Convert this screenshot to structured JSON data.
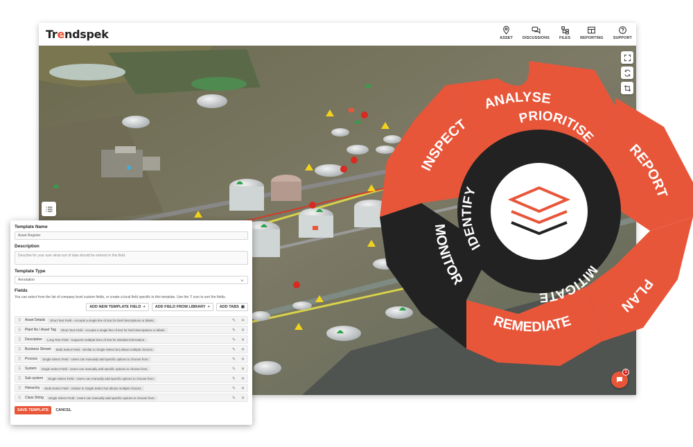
{
  "app": {
    "logo_prefix": "Tr",
    "logo_accent": "e",
    "logo_suffix": "ndspek",
    "accent_color": "#e8563a"
  },
  "nav": {
    "asset": "ASSET",
    "discussions": "DISCUSSIONS",
    "files": "FILES",
    "reporting": "REPORTING",
    "support": "SUPPORT"
  },
  "cycle": {
    "outer": [
      "ANALYSE",
      "REPORT",
      "PLAN",
      "REMEDIATE",
      "MONITOR",
      "INSPECT"
    ],
    "inner": [
      "PRIORITISE",
      "MITIGATE",
      "IDENTIFY"
    ],
    "colors": {
      "outer": "#e8563a",
      "dark": "#222222",
      "center": "#ffffff"
    }
  },
  "chat": {
    "badge_count": "1"
  },
  "template": {
    "name_label": "Template Name",
    "name_value": "Asset Register",
    "description_label": "Description",
    "description_placeholder": "Describe for your user what sort of data should be entered in this field.",
    "type_label": "Template Type",
    "type_value": "Annotation",
    "fields_label": "Fields",
    "fields_help_before": "You can select from the list of company level custom fields, or create a local field specific to this template. Use the",
    "fields_help_after": "icon to sort the fields.",
    "add_new_field": "ADD NEW TEMPLATE FIELD",
    "add_from_library": "ADD FIELD FROM LIBRARY",
    "add_tabs": "ADD TABS",
    "fields": [
      {
        "name": "Asset Details",
        "desc": "Short Text Field - Accepts a single line of text for brief descriptions or labels."
      },
      {
        "name": "Plant No / Asset Tag",
        "desc": "Short Text Field - Accepts a single line of text for brief descriptions or labels."
      },
      {
        "name": "Description",
        "desc": "Long Text Field - Supports multiple lines of text for detailed information."
      },
      {
        "name": "Business Stream",
        "desc": "Multi Select Field - Similar to Single Select but allows multiple choices."
      },
      {
        "name": "Process",
        "desc": "Single Select Field - Users can manually add specific options to choose from."
      },
      {
        "name": "System",
        "desc": "Single Select Field - Users can manually add specific options to choose from."
      },
      {
        "name": "Sub system",
        "desc": "Single Select Field - Users can manually add specific options to choose from."
      },
      {
        "name": "Hierarchy",
        "desc": "Multi Select Field - Similar to Single Select but allows multiple choices."
      },
      {
        "name": "Class String",
        "desc": "Single Select Field - Users can manually add specific options to choose from."
      }
    ],
    "save_label": "SAVE TEMPLATE",
    "cancel_label": "CANCEL"
  }
}
